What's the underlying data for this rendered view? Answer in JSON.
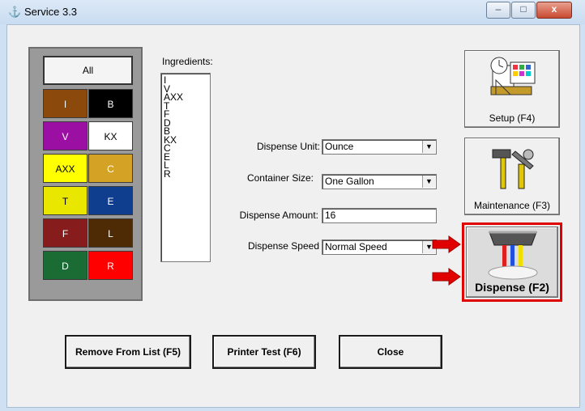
{
  "window": {
    "title": "Service 3.3",
    "app_icon": "app-logo-icon",
    "controls": {
      "minimize": "–",
      "maximize": "□",
      "close": "x"
    }
  },
  "palette": {
    "all_label": "All",
    "cells": [
      {
        "label": "I",
        "color": "#8b4a0b",
        "text_color": "#ffffff"
      },
      {
        "label": "B",
        "color": "#000000",
        "text_color": "#ffffff"
      },
      {
        "label": "V",
        "color": "#9c0fa3",
        "text_color": "#ffffff"
      },
      {
        "label": "KX",
        "color": "#ffffff",
        "text_color": "#000000"
      },
      {
        "label": "AXX",
        "color": "#ffff00",
        "text_color": "#000000"
      },
      {
        "label": "C",
        "color": "#d4a224",
        "text_color": "#ffffff"
      },
      {
        "label": "T",
        "color": "#e9e600",
        "text_color": "#000000"
      },
      {
        "label": "E",
        "color": "#0e3e8d",
        "text_color": "#ffffff"
      },
      {
        "label": "F",
        "color": "#861c1c",
        "text_color": "#ffffff"
      },
      {
        "label": "L",
        "color": "#4f2b05",
        "text_color": "#ffffff"
      },
      {
        "label": "D",
        "color": "#1b6b34",
        "text_color": "#ffffff"
      },
      {
        "label": "R",
        "color": "#ff0000",
        "text_color": "#ffffff"
      }
    ]
  },
  "ingredients": {
    "label": "Ingredients:",
    "items": [
      "I",
      "V",
      "AXX",
      "T",
      "F",
      "D",
      "B",
      "KX",
      "C",
      "E",
      "L",
      "R"
    ]
  },
  "form": {
    "dispense_unit": {
      "label": "Dispense Unit:",
      "value": "Ounce"
    },
    "container_size": {
      "label": "Container Size:",
      "value": "One Gallon"
    },
    "dispense_amount": {
      "label": "Dispense Amount:",
      "value": "16"
    },
    "dispense_speed": {
      "label": "Dispense Speed",
      "value": "Normal Speed"
    }
  },
  "side_buttons": {
    "setup": {
      "label": "Setup (F4)",
      "icon": "setup-icon"
    },
    "maintenance": {
      "label": "Maintenance (F3)",
      "icon": "tools-icon"
    },
    "dispense": {
      "label": "Dispense (F2)",
      "icon": "dispenser-icon"
    }
  },
  "bottom_buttons": {
    "remove": "Remove From List (F5)",
    "printer_test": "Printer Test (F6)",
    "close": "Close"
  },
  "colors": {
    "highlight": "#e00000",
    "arrow": "#e00000"
  }
}
